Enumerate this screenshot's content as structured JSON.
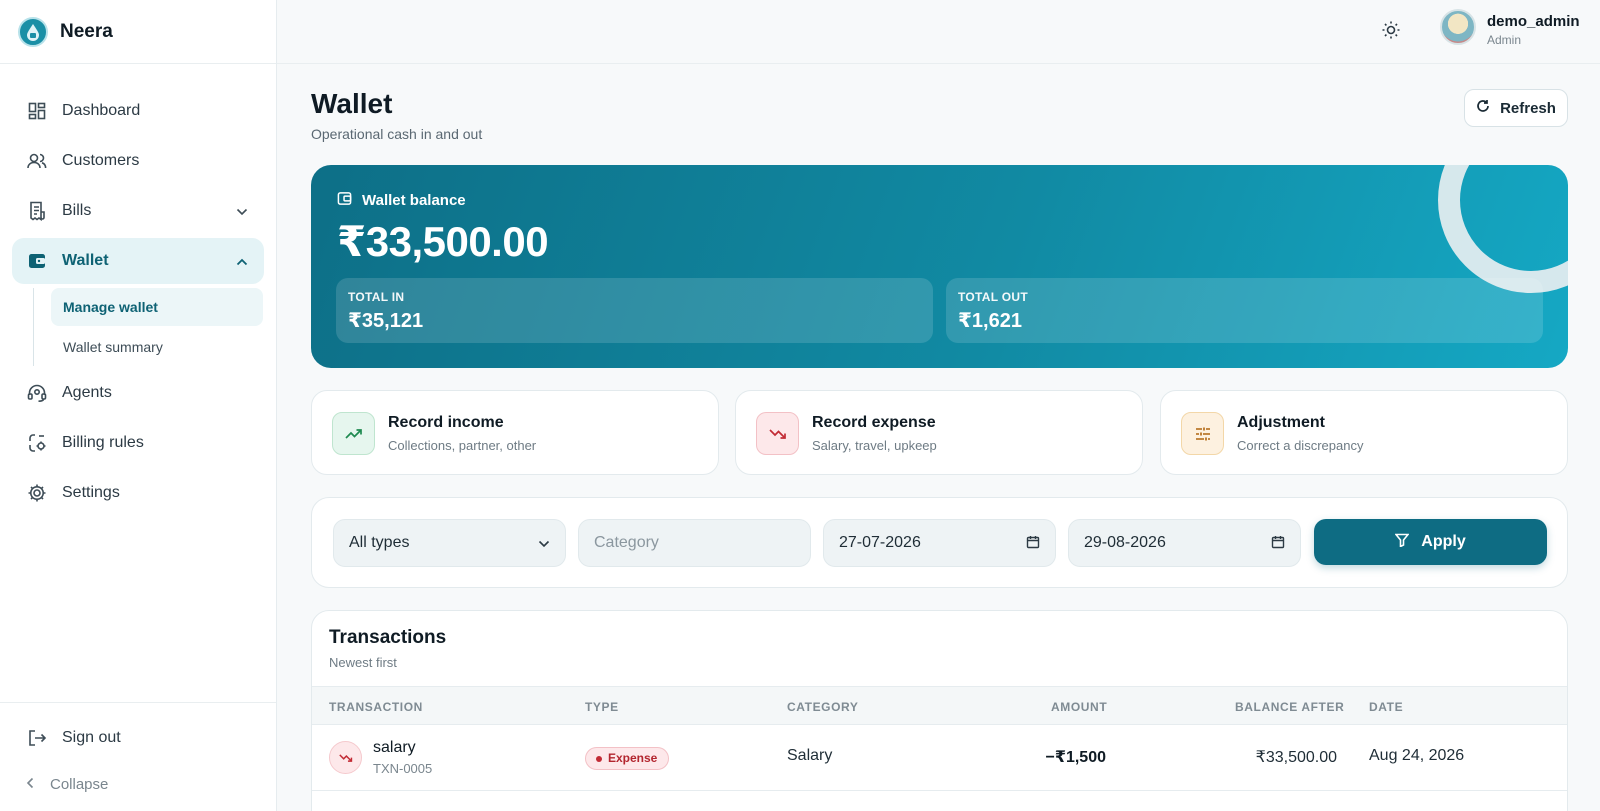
{
  "brand": {
    "name": "Neera"
  },
  "sidebar": {
    "items": [
      {
        "label": "Dashboard",
        "icon": "dashboard-icon"
      },
      {
        "label": "Customers",
        "icon": "users-icon"
      },
      {
        "label": "Bills",
        "icon": "receipt-icon"
      },
      {
        "label": "Wallet",
        "icon": "wallet-icon"
      },
      {
        "label": "Agents",
        "icon": "headset-icon"
      },
      {
        "label": "Billing rules",
        "icon": "rules-icon"
      },
      {
        "label": "Settings",
        "icon": "gear-icon"
      }
    ],
    "wallet_sub": [
      {
        "label": "Manage wallet"
      },
      {
        "label": "Wallet summary"
      }
    ],
    "sign_out": "Sign out",
    "collapse": "Collapse"
  },
  "header": {
    "user_name": "demo_admin",
    "user_role": "Admin"
  },
  "page": {
    "title": "Wallet",
    "subtitle": "Operational cash in and out",
    "refresh_label": "Refresh"
  },
  "balance": {
    "label": "Wallet balance",
    "value": "₹33,500.00",
    "total_in_label": "TOTAL IN",
    "total_in_value": "₹35,121",
    "total_out_label": "TOTAL OUT",
    "total_out_value": "₹1,621"
  },
  "actions": [
    {
      "title": "Record income",
      "subtitle": "Collections, partner, other"
    },
    {
      "title": "Record expense",
      "subtitle": "Salary, travel, upkeep"
    },
    {
      "title": "Adjustment",
      "subtitle": "Correct a discrepancy"
    }
  ],
  "filters": {
    "type_value": "All types",
    "category_placeholder": "Category",
    "from_date": "27-07-2026",
    "to_date": "29-08-2026",
    "apply_label": "Apply"
  },
  "transactions": {
    "title": "Transactions",
    "subtitle": "Newest first",
    "columns": [
      "TRANSACTION",
      "TYPE",
      "CATEGORY",
      "AMOUNT",
      "BALANCE AFTER",
      "DATE"
    ],
    "rows": [
      {
        "name": "salary",
        "id": "TXN-0005",
        "type": "Expense",
        "category": "Salary",
        "amount": "−₹1,500",
        "balance_after": "₹33,500.00",
        "date": "Aug 24, 2026"
      }
    ]
  },
  "colors": {
    "accent": "#0e6c83",
    "active_bg": "#e4f3f6",
    "expense": "#c22b35"
  }
}
